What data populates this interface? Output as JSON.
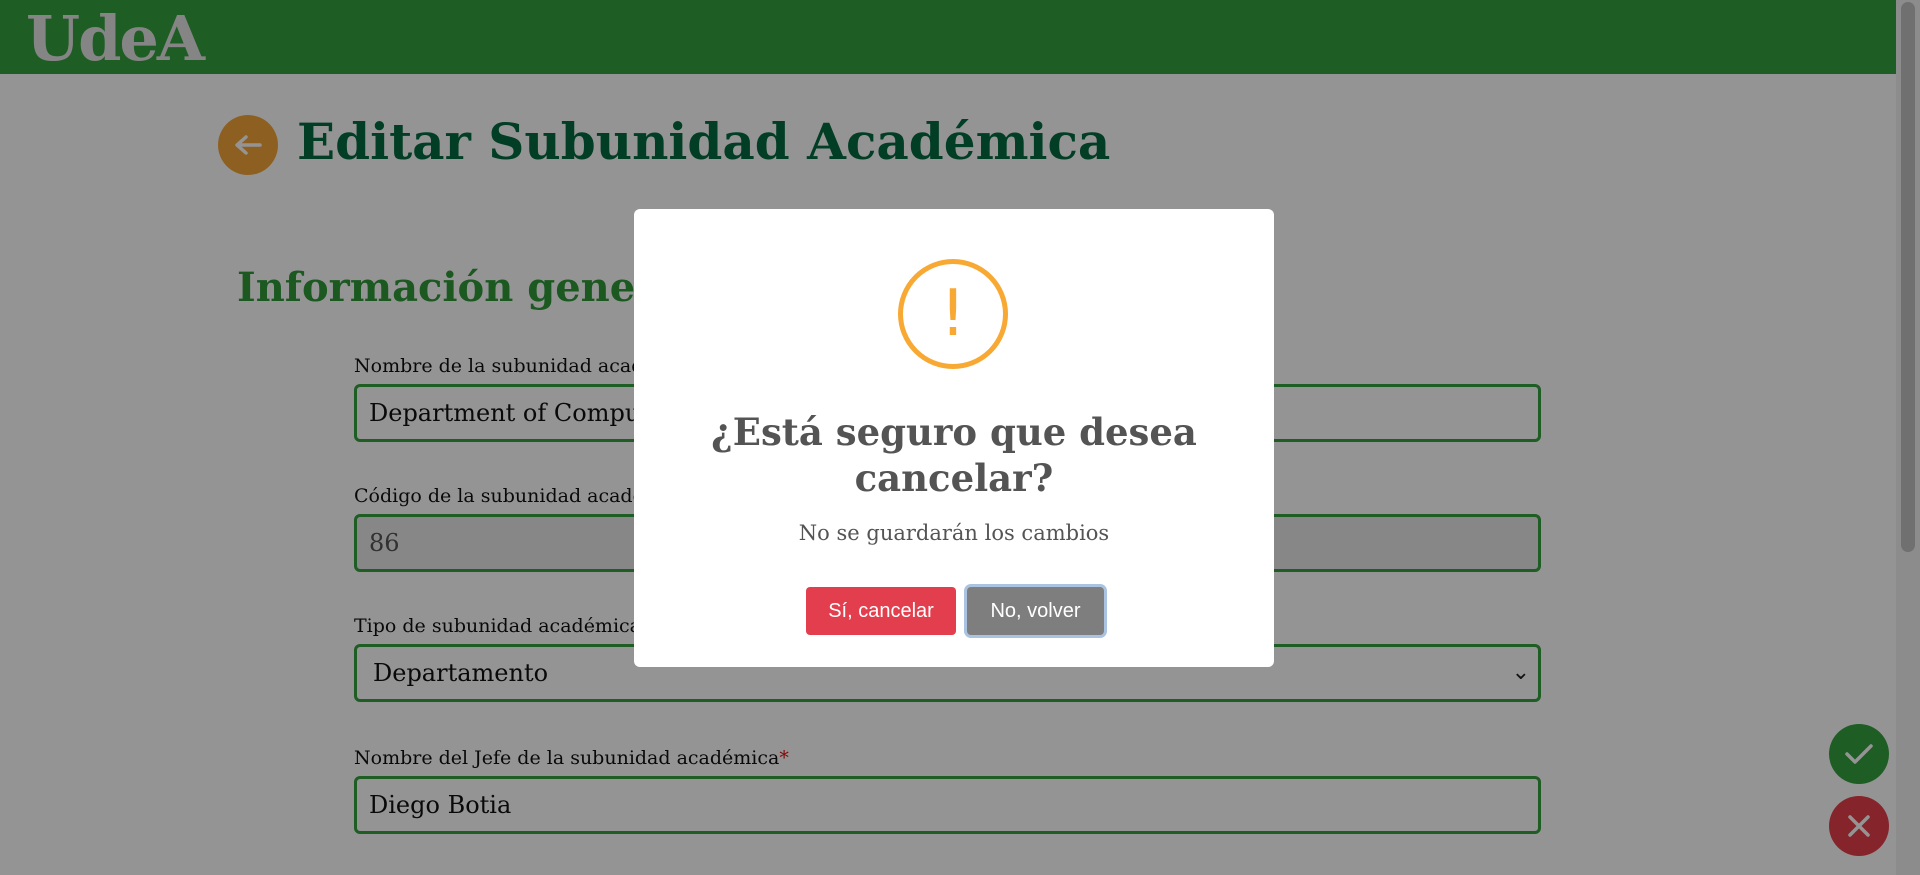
{
  "header": {
    "logo": "UdeA"
  },
  "page": {
    "title": "Editar Subunidad Académica",
    "section_title": "Información general"
  },
  "form": {
    "name_label": "Nombre de la subunidad académica",
    "name_required": "*",
    "name_value": "Department of Computer Science",
    "code_label": "Código de la subunidad académica",
    "code_required": "*",
    "code_value": "86",
    "type_label": "Tipo de subunidad académica",
    "type_required": "*",
    "type_value": "Departamento",
    "chief_label": "Nombre del Jefe de la subunidad académica",
    "chief_required": "*",
    "chief_value": "Diego Botia"
  },
  "modal": {
    "icon": "!",
    "title": "¿Está seguro que desea cancelar?",
    "text": "No se guardarán los cambios",
    "confirm_label": "Sí, cancelar",
    "cancel_label": "No, volver"
  },
  "colors": {
    "brand_green": "#35a03d",
    "title_green": "#026b40",
    "warning_orange": "#f8a933",
    "danger_red": "#e33e4d"
  }
}
